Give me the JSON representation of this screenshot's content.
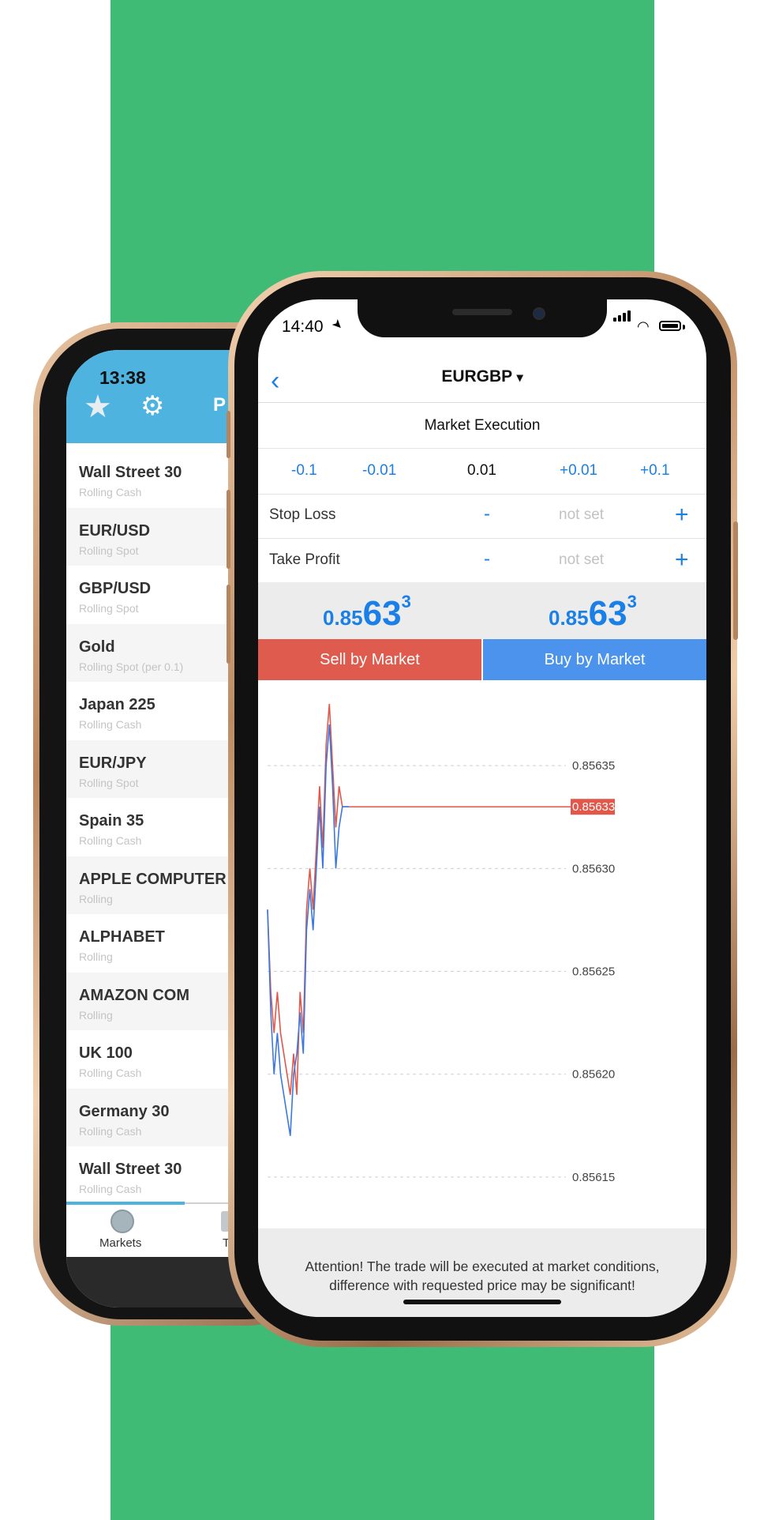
{
  "colors": {
    "background_strip": "#40bb75",
    "accent_blue": "#1a7fe6",
    "sell_red": "#df5b4d",
    "buy_blue": "#4b93ec",
    "back_header": "#4fb3e0"
  },
  "back_phone": {
    "status": {
      "time": "13:38"
    },
    "header": {
      "star_icon": "star-icon",
      "gear_icon": "gear-icon",
      "partial_text": "P"
    },
    "markets": [
      {
        "name": "Wall Street 30",
        "sub": "Rolling Cash"
      },
      {
        "name": "EUR/USD",
        "sub": "Rolling Spot"
      },
      {
        "name": "GBP/USD",
        "sub": "Rolling Spot"
      },
      {
        "name": "Gold",
        "sub": "Rolling Spot (per 0.1)"
      },
      {
        "name": "Japan 225",
        "sub": "Rolling Cash"
      },
      {
        "name": "EUR/JPY",
        "sub": "Rolling Spot"
      },
      {
        "name": "Spain 35",
        "sub": "Rolling Cash"
      },
      {
        "name": "APPLE COMPUTER",
        "sub": "Rolling"
      },
      {
        "name": "ALPHABET",
        "sub": "Rolling"
      },
      {
        "name": "AMAZON COM",
        "sub": "Rolling"
      },
      {
        "name": "UK 100",
        "sub": "Rolling Cash"
      },
      {
        "name": "Germany 30",
        "sub": "Rolling Cash"
      },
      {
        "name": "Wall Street 30",
        "sub": "Rolling Cash"
      }
    ],
    "tabbar": {
      "markets_label": "Markets",
      "second_label_partial": "T"
    }
  },
  "front_phone": {
    "status": {
      "time": "14:40"
    },
    "nav": {
      "title": "EURGBP",
      "dropdown_glyph": "▾"
    },
    "execution_label": "Market Execution",
    "volume": {
      "steps": [
        "-0.1",
        "-0.01",
        "+0.01",
        "+0.1"
      ],
      "value": "0.01"
    },
    "stop_loss": {
      "label": "Stop Loss",
      "minus": "-",
      "value": "not set",
      "plus": "+"
    },
    "take_profit": {
      "label": "Take Profit",
      "minus": "-",
      "value": "not set",
      "plus": "+"
    },
    "sell_price": {
      "prefix": "0.85",
      "big": "63",
      "sup": "3"
    },
    "buy_price": {
      "prefix": "0.85",
      "big": "63",
      "sup": "3"
    },
    "sell_button": "Sell by Market",
    "buy_button": "Buy by Market",
    "attention": "Attention! The trade will be executed at market conditions, difference with requested price may be significant!"
  },
  "chart_data": {
    "type": "line",
    "ylim": [
      0.856125,
      0.85639
    ],
    "yticks": [
      "0.85635",
      "0.85630",
      "0.85625",
      "0.85620",
      "0.85615"
    ],
    "current_price_label": "0.85633",
    "current_price": 0.85633,
    "grid": "horizontal dashed",
    "series": [
      {
        "color": "#e1574a",
        "values": [
          0.85628,
          0.85624,
          0.85622,
          0.85624,
          0.85622,
          0.85621,
          0.8562,
          0.85619,
          0.85621,
          0.85619,
          0.85624,
          0.85622,
          0.85628,
          0.8563,
          0.85628,
          0.85631,
          0.85634,
          0.85631,
          0.85636,
          0.85638,
          0.85635,
          0.85632,
          0.85634,
          0.85633,
          0.85633,
          0.85633
        ]
      },
      {
        "color": "#3c78e0",
        "values": [
          0.85628,
          0.85623,
          0.8562,
          0.85622,
          0.8562,
          0.85619,
          0.85618,
          0.85617,
          0.8562,
          0.85621,
          0.85623,
          0.85621,
          0.85627,
          0.85629,
          0.85627,
          0.8563,
          0.85633,
          0.8563,
          0.85635,
          0.85637,
          0.85634,
          0.8563,
          0.85632,
          0.85633,
          0.85633,
          0.85633
        ]
      }
    ]
  }
}
